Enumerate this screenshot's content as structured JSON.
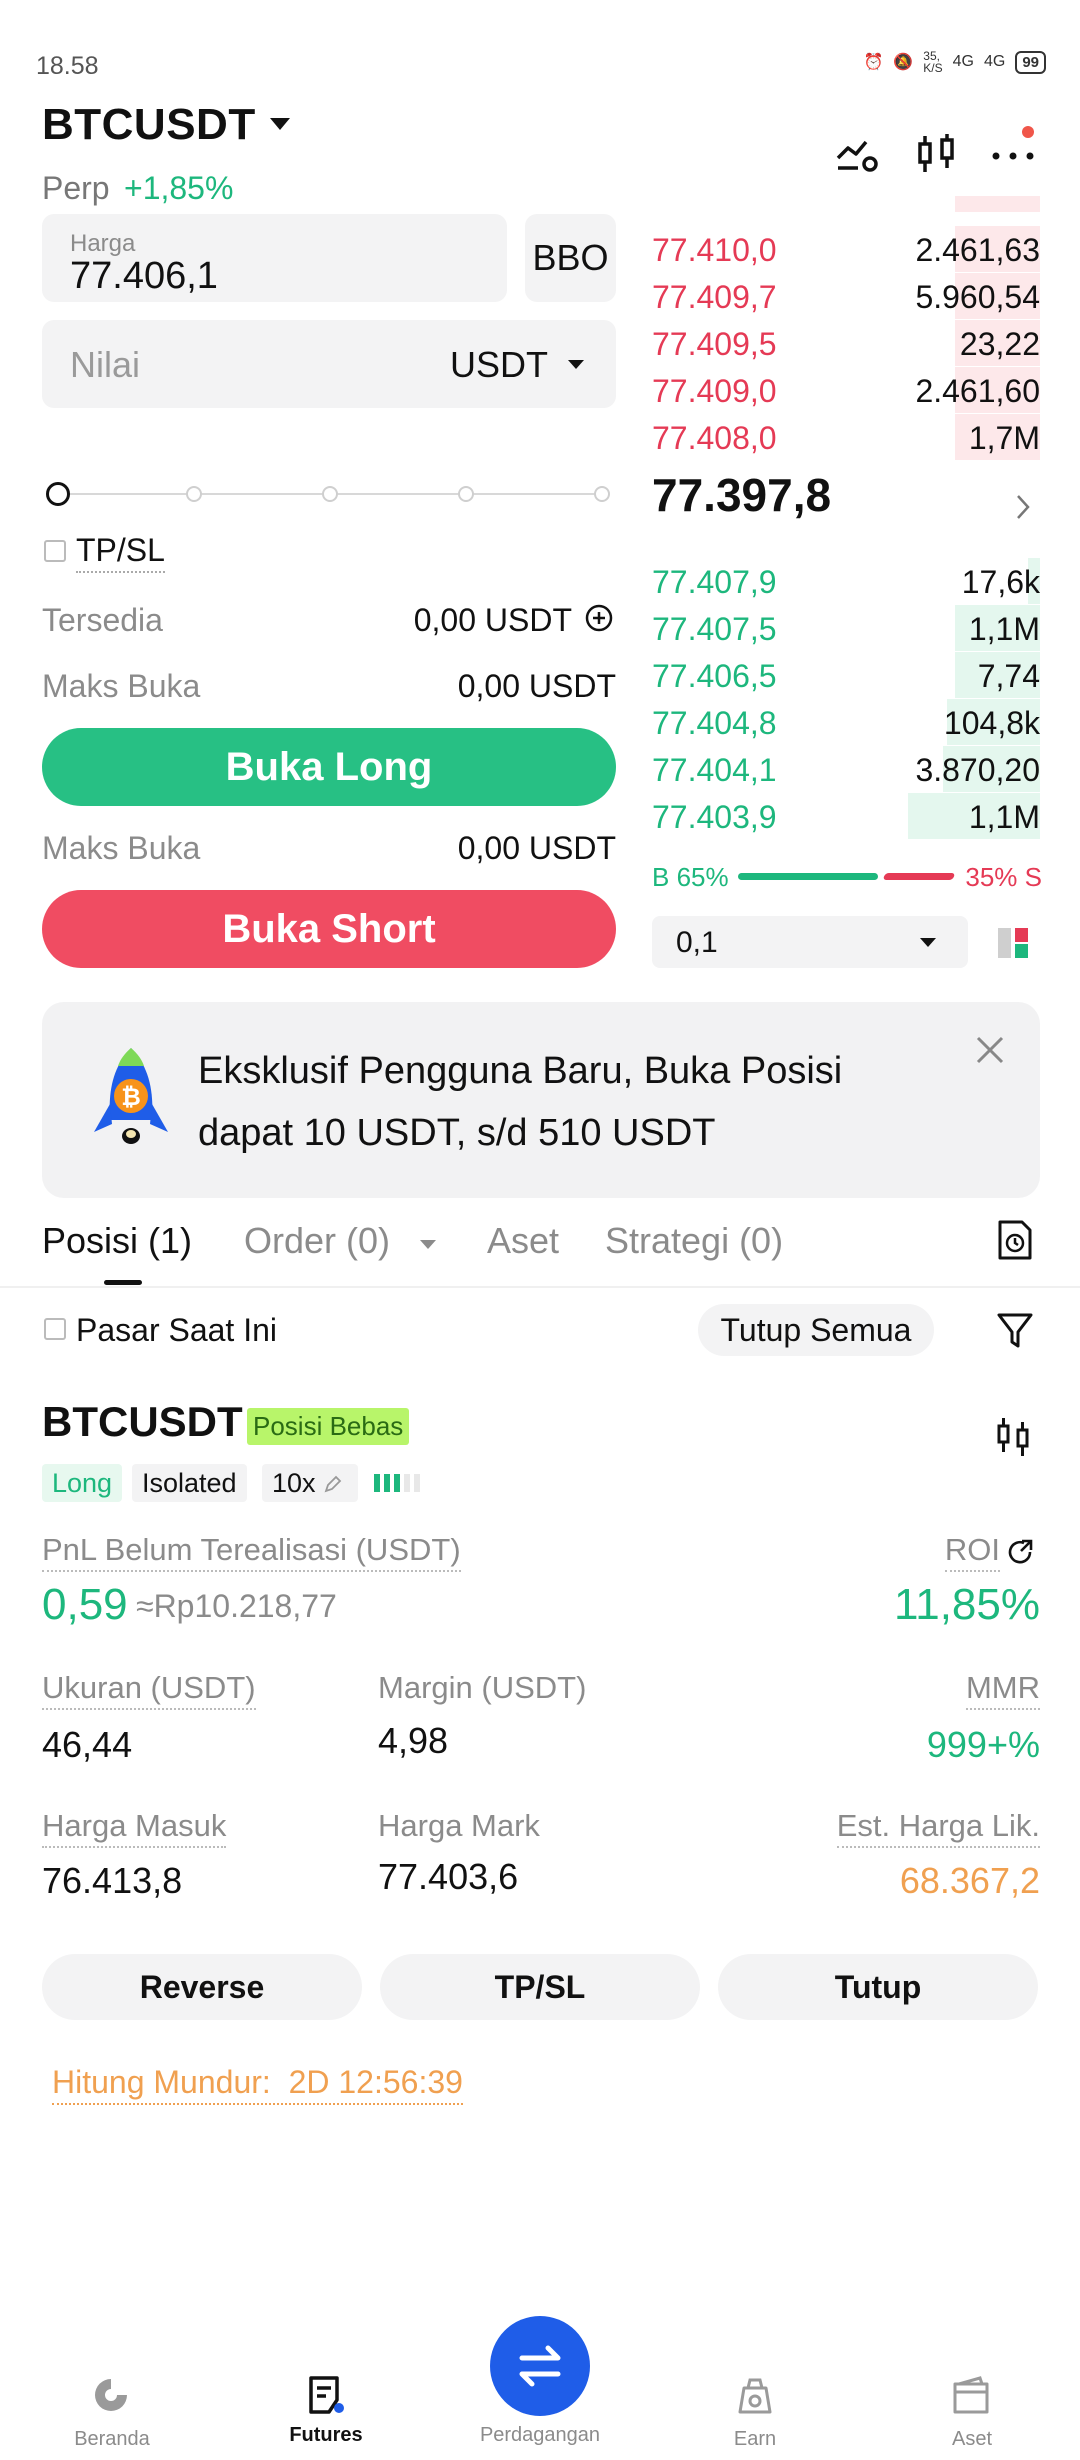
{
  "status_bar": {
    "time": "18.58",
    "net_speed": "35,\nK/S",
    "net1": "4G",
    "net2": "4G",
    "battery": "99"
  },
  "header": {
    "pair": "BTCUSDT",
    "contract_type": "Perp",
    "change": "+1,85%"
  },
  "order_form": {
    "price_label": "Harga",
    "price_value": "77.406,1",
    "bbo_label": "BBO",
    "value_placeholder": "Nilai",
    "unit_select": "USDT",
    "tpsl_label": "TP/SL",
    "available_label": "Tersedia",
    "available_value": "0,00 USDT",
    "max_open_label": "Maks Buka",
    "max_open_long": "0,00 USDT",
    "max_open_short": "0,00 USDT",
    "open_long": "Buka Long",
    "open_short": "Buka Short"
  },
  "order_book": {
    "asks": [
      {
        "price": "77.410,0",
        "qty": "2.461,63",
        "depth": 0.22
      },
      {
        "price": "77.409,7",
        "qty": "5.960,54",
        "depth": 0.22
      },
      {
        "price": "77.409,5",
        "qty": "23,22",
        "depth": 0.22
      },
      {
        "price": "77.409,0",
        "qty": "2.461,60",
        "depth": 0.22
      },
      {
        "price": "77.408,0",
        "qty": "1,7M",
        "depth": 0.22
      }
    ],
    "mid_price": "77.397,8",
    "bids": [
      {
        "price": "77.407,9",
        "qty": "17,6k",
        "depth": 0.03
      },
      {
        "price": "77.407,5",
        "qty": "1,1M",
        "depth": 0.22
      },
      {
        "price": "77.406,5",
        "qty": "7,74",
        "depth": 0.22
      },
      {
        "price": "77.404,8",
        "qty": "104,8k",
        "depth": 0.24
      },
      {
        "price": "77.404,1",
        "qty": "3.870,20",
        "depth": 0.25
      },
      {
        "price": "77.403,9",
        "qty": "1,1M",
        "depth": 0.34
      }
    ],
    "buy_ratio": "B 65%",
    "sell_ratio": "35% S",
    "precision": "0,1"
  },
  "promo": {
    "text": "Eksklusif Pengguna Baru, Buka Posisi dapat 10 USDT, s/d 510 USDT"
  },
  "tabs": {
    "positions": "Posisi (1)",
    "orders": "Order (0)",
    "assets": "Aset",
    "strategy": "Strategi (0)"
  },
  "filters": {
    "current_market": "Pasar Saat Ini",
    "close_all": "Tutup Semua"
  },
  "position": {
    "symbol": "BTCUSDT",
    "badge": "Posisi Bebas",
    "side": "Long",
    "margin_mode": "Isolated",
    "leverage": "10x",
    "pnl_label": "PnL Belum Terealisasi (USDT)",
    "pnl_value": "0,59",
    "pnl_idr": "≈Rp10.218,77",
    "roi_label": "ROI",
    "roi_value": "11,85%",
    "size_label": "Ukuran (USDT)",
    "size_value": "46,44",
    "margin_label": "Margin (USDT)",
    "margin_value": "4,98",
    "mmr_label": "MMR",
    "mmr_value": "999+%",
    "entry_label": "Harga Masuk",
    "entry_value": "76.413,8",
    "mark_label": "Harga Mark",
    "mark_value": "77.403,6",
    "liq_label": "Est. Harga Lik.",
    "liq_value": "68.367,2",
    "reverse": "Reverse",
    "tpsl": "TP/SL",
    "close": "Tutup",
    "countdown": "Hitung Mundur:  2D 12:56:39"
  },
  "nav": {
    "home": "Beranda",
    "futures": "Futures",
    "trade": "Perdagangan",
    "earn": "Earn",
    "assets": "Aset"
  },
  "colors": {
    "green": "#1db77d",
    "red": "#e53a55",
    "brand_blue": "#1f5de8",
    "orange": "#f0a050"
  }
}
